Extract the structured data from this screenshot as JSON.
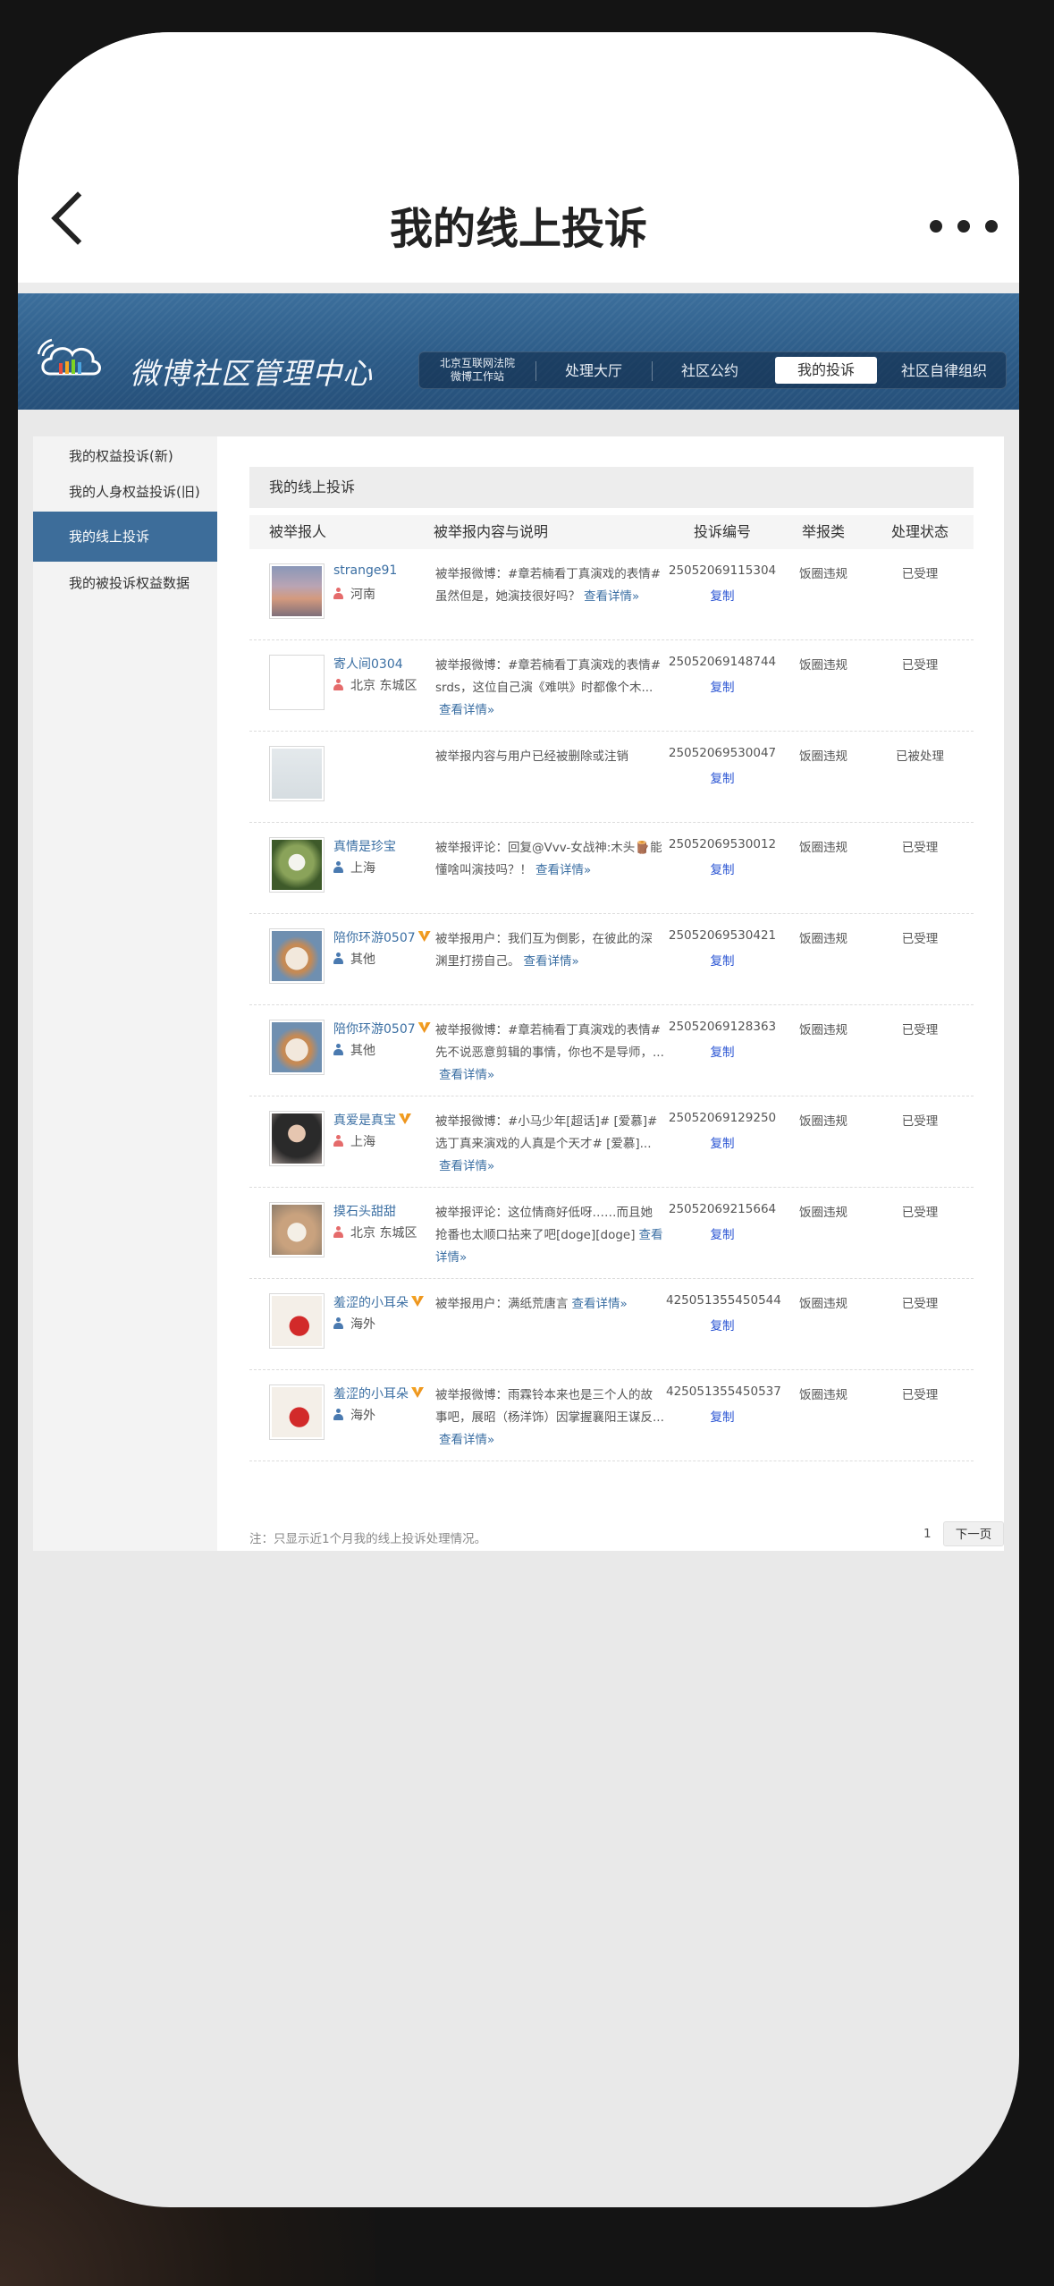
{
  "nav": {
    "title": "我的线上投诉"
  },
  "banner": {
    "brand": "微博社区管理中心",
    "court_line1": "北京互联网法院",
    "court_line2": "微博工作站",
    "tabs": [
      "处理大厅",
      "社区公约",
      "我的投诉",
      "社区自律组织"
    ],
    "active_tab": "我的投诉"
  },
  "sidebar": {
    "items": [
      "我的权益投诉(新)",
      "我的人身权益投诉(旧)",
      "我的线上投诉",
      "我的被投诉权益数据"
    ],
    "active": "我的线上投诉"
  },
  "main": {
    "title": "我的线上投诉",
    "columns": [
      "被举报人",
      "被举报内容与说明",
      "投诉编号",
      "举报类",
      "处理状态"
    ],
    "rows": [
      {
        "nick": "strange91",
        "verified": false,
        "gender": "female",
        "location": "河南",
        "desc": "被举报微博：#章若楠看丁真演戏的表情#虽然但是，她演技很好吗？",
        "more": "查看详情»",
        "id": "25052069115304",
        "copy": "复制",
        "category": "饭圈违规",
        "status": "已受理"
      },
      {
        "nick": "寄人间0304",
        "verified": false,
        "gender": "female",
        "location": "北京 东城区",
        "desc": "被举报微博：#章若楠看丁真演戏的表情#srds，这位自己演《难哄》时都像个木...",
        "more": "查看详情»",
        "id": "25052069148744",
        "copy": "复制",
        "category": "饭圈违规",
        "status": "已受理"
      },
      {
        "nick": "",
        "verified": false,
        "gender": "",
        "location": "",
        "desc": "被举报内容与用户已经被删除或注销",
        "more": "",
        "id": "25052069530047",
        "copy": "复制",
        "category": "饭圈违规",
        "status": "已被处理"
      },
      {
        "nick": "真情是珍宝",
        "verified": false,
        "gender": "male",
        "location": "上海",
        "desc": "被举报评论：回复@Vvv-女战神:木头🪵能懂啥叫演技吗？！",
        "more": "查看详情»",
        "id": "25052069530012",
        "copy": "复制",
        "category": "饭圈违规",
        "status": "已受理"
      },
      {
        "nick": "陪你环游0507",
        "verified": true,
        "gender": "male",
        "location": "其他",
        "desc": "被举报用户：我们互为倒影，在彼此的深渊里打捞自己。",
        "more": "查看详情»",
        "id": "25052069530421",
        "copy": "复制",
        "category": "饭圈违规",
        "status": "已受理"
      },
      {
        "nick": "陪你环游0507",
        "verified": true,
        "gender": "male",
        "location": "其他",
        "desc": "被举报微博：#章若楠看丁真演戏的表情#先不说恶意剪辑的事情，你也不是导师，...",
        "more": "查看详情»",
        "id": "25052069128363",
        "copy": "复制",
        "category": "饭圈违规",
        "status": "已受理"
      },
      {
        "nick": "真爱是真宝",
        "verified": true,
        "gender": "female",
        "location": "上海",
        "desc": "被举报微博：#小马少年[超话]# [爱慕]#选丁真来演戏的人真是个天才# [爱慕]...",
        "more": "查看详情»",
        "id": "25052069129250",
        "copy": "复制",
        "category": "饭圈违规",
        "status": "已受理"
      },
      {
        "nick": "摸石头甜甜",
        "verified": false,
        "gender": "female",
        "location": "北京 东城区",
        "desc": "被举报评论：这位情商好低呀……而且她抢番也太顺口拈来了吧[doge][doge]",
        "more": "查看详情»",
        "id": "25052069215664",
        "copy": "复制",
        "category": "饭圈违规",
        "status": "已受理"
      },
      {
        "nick": "羞涩的小耳朵",
        "verified": true,
        "gender": "male",
        "location": "海外",
        "desc": "被举报用户：满纸荒唐言",
        "more": "查看详情»",
        "id": "425051355450544",
        "copy": "复制",
        "category": "饭圈违规",
        "status": "已受理"
      },
      {
        "nick": "羞涩的小耳朵",
        "verified": true,
        "gender": "male",
        "location": "海外",
        "desc": "被举报微博：雨霖铃本来也是三个人的故事吧，展昭（杨洋饰）因掌握襄阳王谋反...",
        "more": "查看详情»",
        "id": "425051355450537",
        "copy": "复制",
        "category": "饭圈违规",
        "status": "已受理"
      }
    ],
    "note": "注：只显示近1个月我的线上投诉处理情况。",
    "page": "1",
    "next": "下一页"
  },
  "colors": {
    "banner": "#2d5c88",
    "sidebar_active": "#3d6d9a",
    "link": "#3b6fa3",
    "copy": "#2a54d3",
    "female_icon": "#e56b6b",
    "male_icon": "#4a7ab0",
    "verified": "#f5a623"
  },
  "icons": {
    "back": "chevron-left-icon",
    "more": "ellipsis-icon",
    "logo": "cloud-logo-icon",
    "verified": "verified-v-icon",
    "gender": "person-icon"
  }
}
